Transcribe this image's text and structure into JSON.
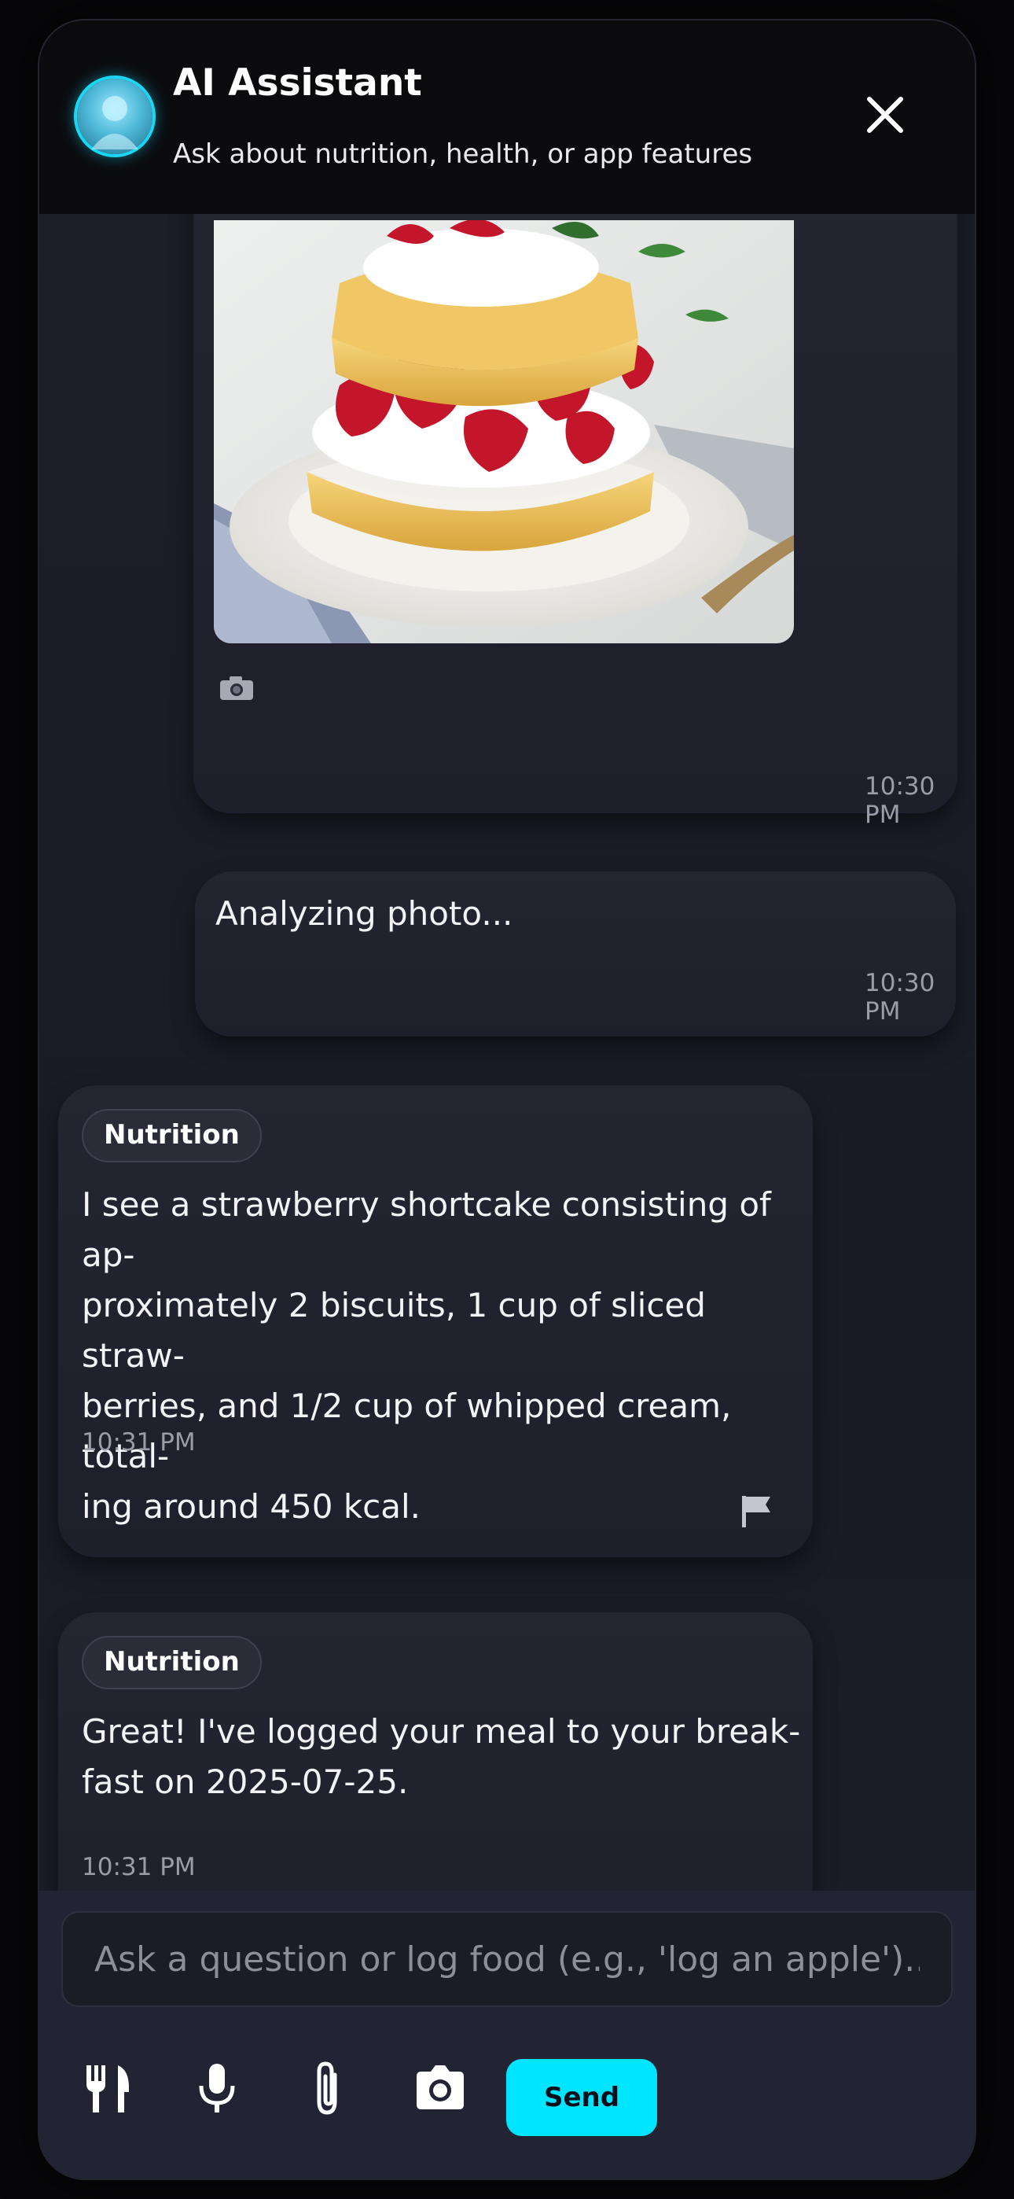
{
  "header": {
    "title": "AI Assistant",
    "subtitle": "Ask about nutrition, health, or app features"
  },
  "messages": [
    {
      "type": "user-photo",
      "photo_caption_icon": "camera-icon",
      "time": "10:30 PM"
    },
    {
      "type": "user-text",
      "text": "Analyzing photo...",
      "time": "10:30 PM"
    },
    {
      "type": "assistant",
      "badge": "Nutrition",
      "lines": [
        "I see a strawberry shortcake consisting of ap-",
        "proximately 2 biscuits, 1 cup of sliced straw-",
        "berries, and 1/2 cup of whipped cream, total-",
        "ing around 450 kcal."
      ],
      "time": "10:31 PM"
    },
    {
      "type": "assistant",
      "badge": "Nutrition",
      "lines": [
        "Great! I've logged your meal to your break-",
        "fast on 2025-07-25."
      ],
      "time": "10:31 PM"
    }
  ],
  "composer": {
    "placeholder": "Ask a question or log food (e.g., 'log an apple')...",
    "value": "",
    "send_label": "Send"
  },
  "colors": {
    "accent": "#00e5ff",
    "background": "#1d1e28",
    "header": "#0b0b0e"
  }
}
